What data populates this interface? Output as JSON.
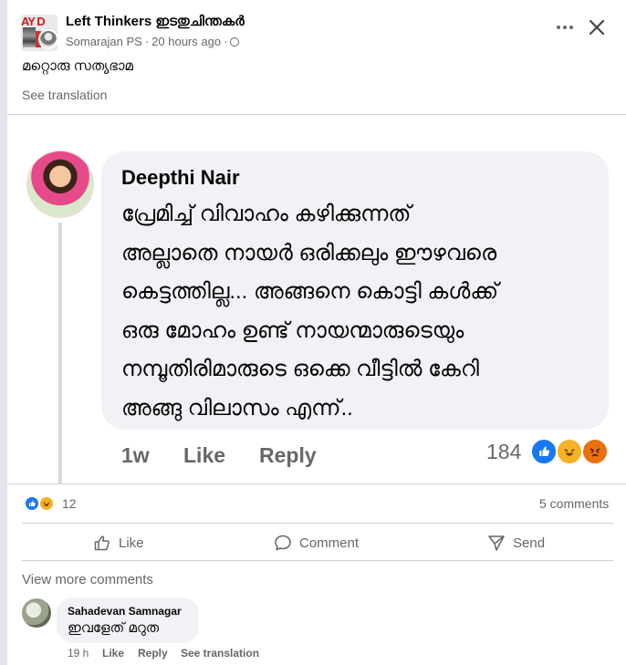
{
  "post": {
    "group_name": "Left Thinkers ഇടതുചിന്തകർ",
    "author": "Somarajan PS",
    "time": "20 hours ago",
    "separator": "·",
    "text": "മറ്റൊരു സത്യഭാമ",
    "see_translation": "See translation",
    "logo_text": "AY D"
  },
  "screenshot": {
    "commenter_name": "Deepthi Nair",
    "comment_lines": [
      "പ്രേമിച്ച് വിവാഹം കഴിക്കുന്നത്",
      "അല്ലാതെ നായർ ഒരിക്കലും ഈഴവരെ",
      "കെട്ടത്തില്ല... അങ്ങനെ കൊട്ടി കൾക്ക്",
      "ഒരു മോഹം ഉണ്ട് നായന്മാരുടെയും",
      "നമ്പൂതിരിമാരുടെ ഒക്കെ വീട്ടിൽ കേറി",
      "അങ്ങു വിലാസം എന്ന്.."
    ],
    "time": "1w",
    "like": "Like",
    "reply": "Reply",
    "reaction_count": "184"
  },
  "stats": {
    "reactions": "12",
    "comments": "5 comments"
  },
  "actions": {
    "like": "Like",
    "comment": "Comment",
    "send": "Send"
  },
  "comments": {
    "view_more": "View more comments",
    "items": [
      {
        "name": "Sahadevan Samnagar",
        "text": "ഇവളേത് മറുത",
        "time": "19 h",
        "like": "Like",
        "reply": "Reply",
        "see_translation": "See translation"
      }
    ]
  },
  "icons": {
    "like": "thumbs-up-icon",
    "comment": "speech-bubble-icon",
    "send": "send-icon",
    "more": "more-horizontal-icon",
    "close": "close-icon",
    "globe": "globe-icon"
  },
  "colors": {
    "like_blue": "#1877f2",
    "haha_yellow": "#f7b125",
    "angry_orange": "#e9710f",
    "secondary_text": "#65676b"
  }
}
